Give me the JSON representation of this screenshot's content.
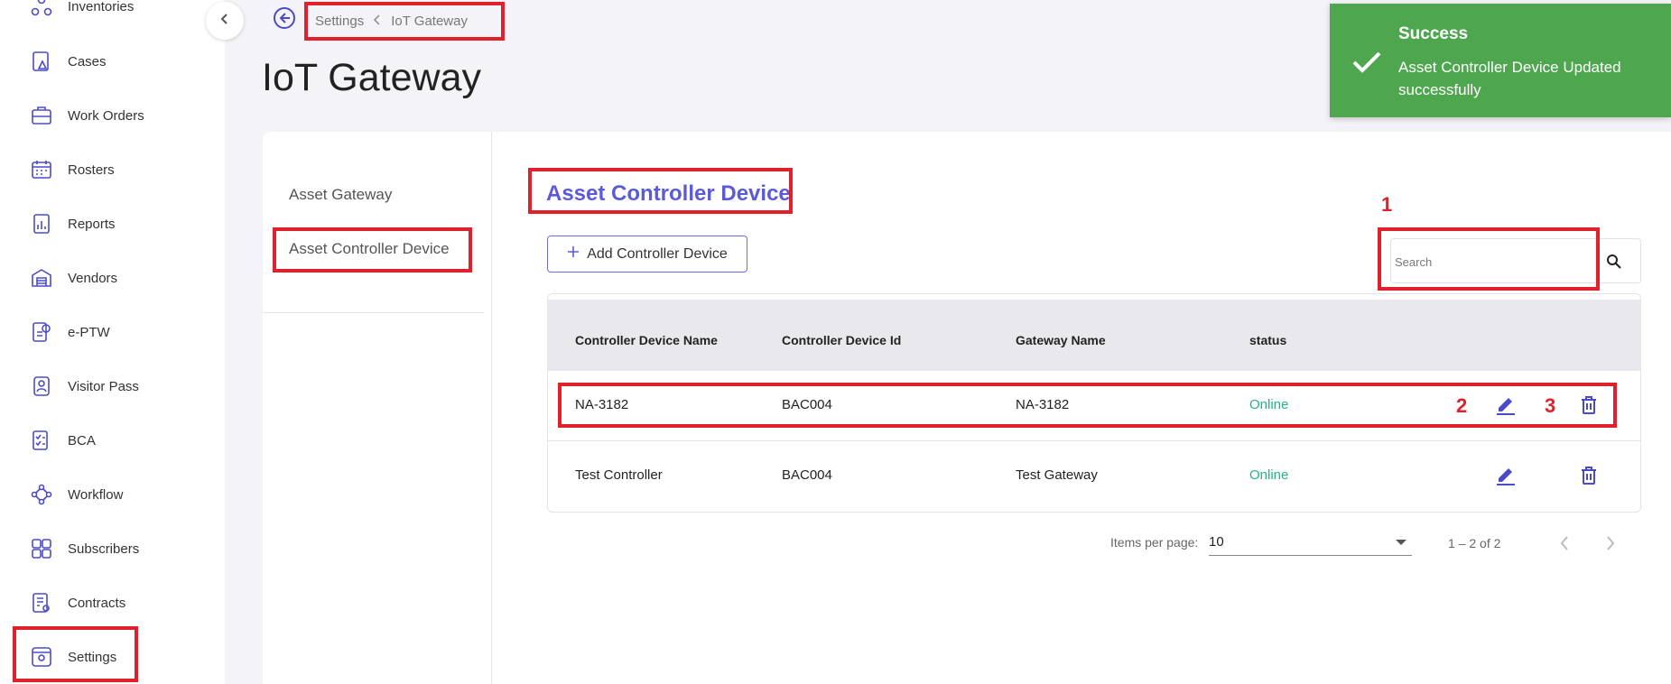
{
  "sidebar": {
    "items": [
      {
        "label": "Inventories",
        "icon": "inventories-icon"
      },
      {
        "label": "Cases",
        "icon": "cases-icon"
      },
      {
        "label": "Work Orders",
        "icon": "work-orders-icon"
      },
      {
        "label": "Rosters",
        "icon": "rosters-icon"
      },
      {
        "label": "Reports",
        "icon": "reports-icon"
      },
      {
        "label": "Vendors",
        "icon": "vendors-icon"
      },
      {
        "label": "e-PTW",
        "icon": "eptw-icon"
      },
      {
        "label": "Visitor Pass",
        "icon": "visitor-pass-icon"
      },
      {
        "label": "BCA",
        "icon": "bca-icon"
      },
      {
        "label": "Workflow",
        "icon": "workflow-icon"
      },
      {
        "label": "Subscribers",
        "icon": "subscribers-icon"
      },
      {
        "label": "Contracts",
        "icon": "contracts-icon"
      },
      {
        "label": "Settings",
        "icon": "settings-icon"
      }
    ]
  },
  "breadcrumb": {
    "root": "Settings",
    "current": "IoT Gateway"
  },
  "page": {
    "title": "IoT Gateway"
  },
  "subnav": {
    "items": [
      {
        "label": "Asset Gateway"
      },
      {
        "label": "Asset Controller Device"
      }
    ]
  },
  "section": {
    "title": "Asset Controller Device",
    "add_label": "Add Controller Device"
  },
  "search": {
    "placeholder": "Search"
  },
  "table": {
    "headers": [
      "Controller Device Name",
      "Controller Device Id",
      "Gateway Name",
      "status"
    ],
    "rows": [
      {
        "name": "NA-3182",
        "id": "BAC004",
        "gateway": "NA-3182",
        "status": "Online"
      },
      {
        "name": "Test Controller",
        "id": "BAC004",
        "gateway": "Test Gateway",
        "status": "Online"
      }
    ]
  },
  "paginator": {
    "items_per_page_label": "Items per page:",
    "page_size": "10",
    "range": "1 – 2 of 2"
  },
  "toast": {
    "title": "Success",
    "message": "Asset Controller Device Updated successfully"
  },
  "annotations": {
    "labels": [
      "1",
      "2",
      "3"
    ]
  },
  "colors": {
    "accent": "#5b5bd6",
    "success": "#4ea64f",
    "online": "#21b58a",
    "highlight": "#e0202a",
    "icon": "#4b4bc9"
  }
}
